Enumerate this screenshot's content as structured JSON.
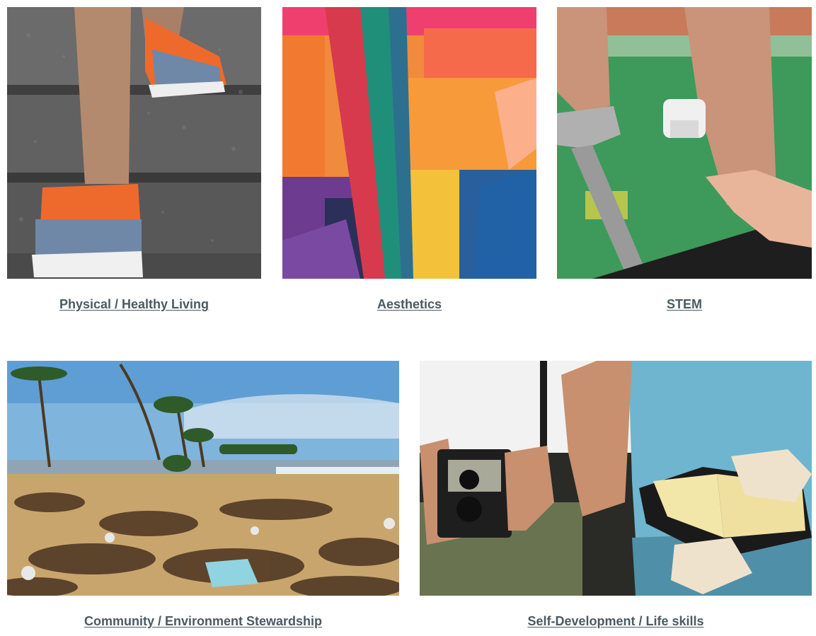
{
  "categories": [
    {
      "id": "physical",
      "label": "Physical / Healthy Living",
      "image": "running-shoes-on-stairs-photo"
    },
    {
      "id": "aesthetics",
      "label": "Aesthetics",
      "image": "abstract-painting-photo"
    },
    {
      "id": "stem",
      "label": "STEM",
      "image": "laptop-sensor-experiment-photo"
    },
    {
      "id": "community",
      "label": "Community / Environment Stewardship",
      "image": "littered-beach-photo"
    },
    {
      "id": "self",
      "label": "Self-Development / Life skills",
      "image": "vintage-camera-and-book-photo"
    }
  ],
  "colors": {
    "caption": "#4a5a63",
    "background": "#ffffff"
  }
}
